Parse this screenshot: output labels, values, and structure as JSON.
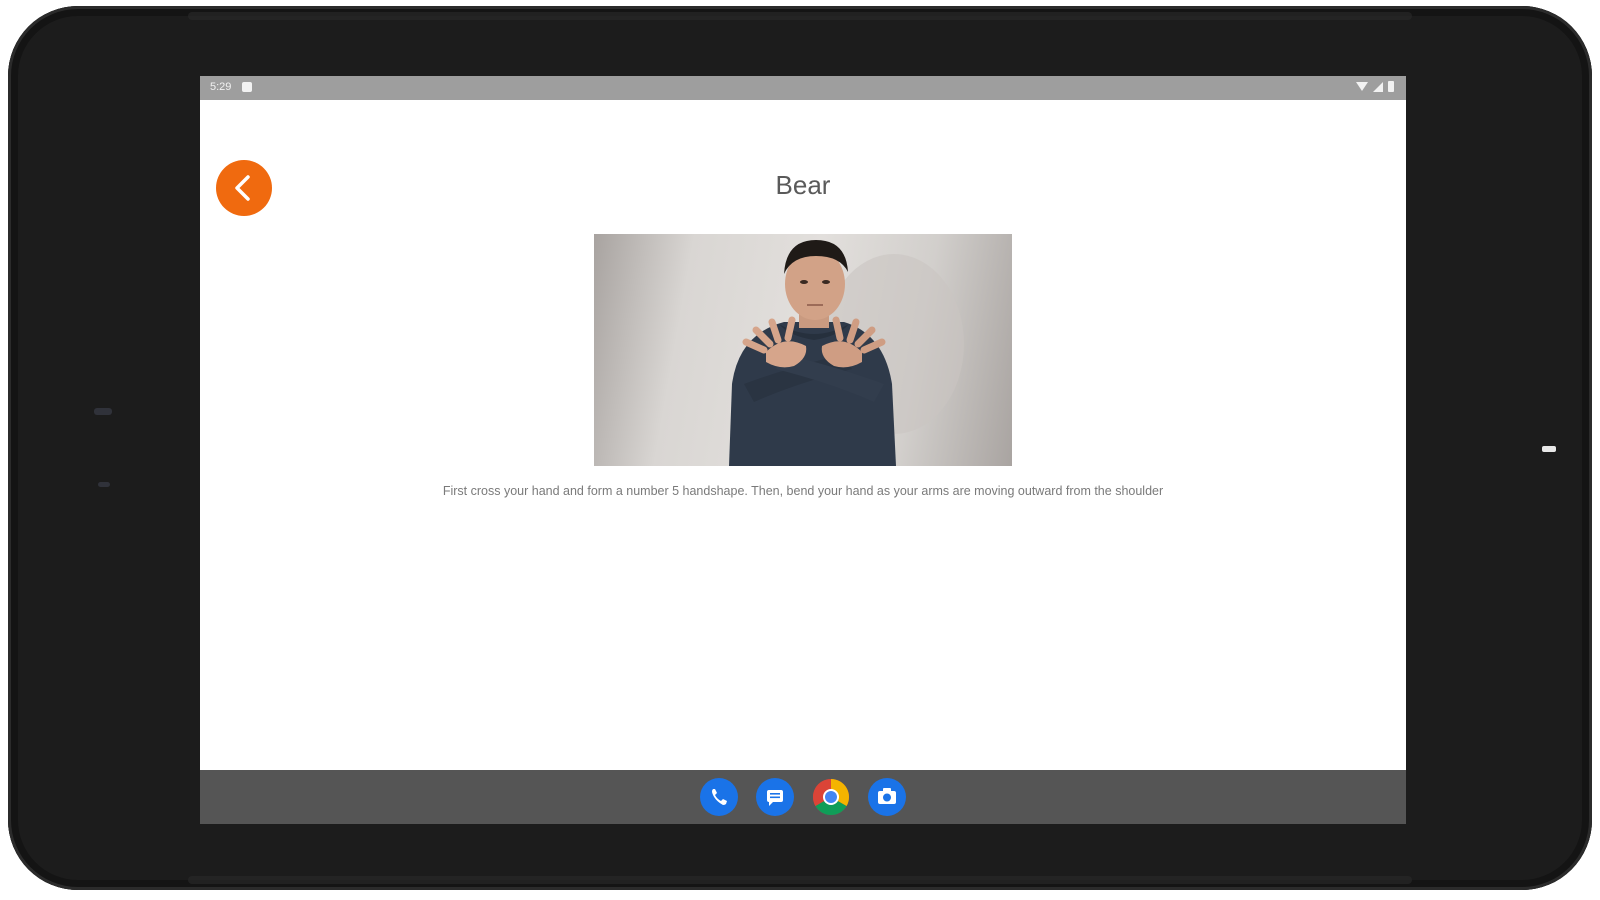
{
  "status_bar": {
    "time": "5:29"
  },
  "header": {
    "title": "Bear"
  },
  "content": {
    "caption": "First cross your hand and form a number 5 handshape. Then, bend your hand as your arms are moving outward from the shoulder"
  },
  "dock": {
    "apps": [
      "phone-icon",
      "messages-icon",
      "chrome-icon",
      "camera-icon"
    ]
  },
  "colors": {
    "accent": "#f06a0f",
    "status_bar": "#9e9e9e",
    "nav_bar": "#555555",
    "dock_blue": "#1a73e8"
  }
}
